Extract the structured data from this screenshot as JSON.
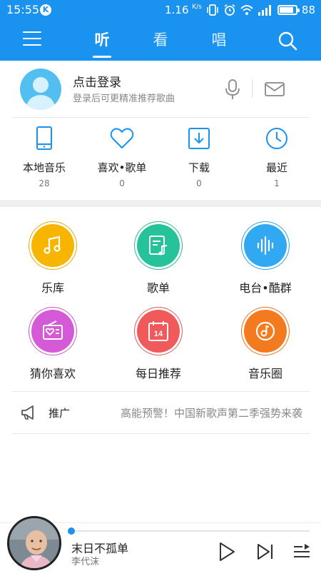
{
  "status_bar": {
    "time": "15:55",
    "k_badge": "K",
    "speed": "1.16",
    "speed_unit": "K/s",
    "battery": "88",
    "battery_level": 0.88
  },
  "nav": {
    "tabs": [
      {
        "label": "听",
        "active": true
      },
      {
        "label": "看",
        "active": false
      },
      {
        "label": "唱",
        "active": false
      }
    ],
    "icons": [
      "menu-icon",
      "search-icon"
    ]
  },
  "login": {
    "title": "点击登录",
    "subtitle": "登录后可更精准推荐歌曲",
    "icons": [
      "avatar-icon",
      "microphone-icon",
      "mail-icon"
    ]
  },
  "stats": [
    {
      "label": "本地音乐",
      "count": "28",
      "icon": "phone-icon"
    },
    {
      "label": "喜欢•歌单",
      "count": "0",
      "icon": "heart-icon"
    },
    {
      "label": "下载",
      "count": "0",
      "icon": "download-icon"
    },
    {
      "label": "最近",
      "count": "1",
      "icon": "clock-icon"
    }
  ],
  "grid": [
    {
      "label": "乐库",
      "icon": "music-note-icon",
      "color": "#f7b500"
    },
    {
      "label": "歌单",
      "icon": "playlist-icon",
      "color": "#26c39a"
    },
    {
      "label": "电台•酷群",
      "icon": "soundwave-icon",
      "color": "#31a8f2"
    },
    {
      "label": "猜你喜欢",
      "icon": "radio-heart-icon",
      "color": "#d55ad8"
    },
    {
      "label": "每日推荐",
      "icon": "calendar-icon",
      "color": "#f15a5a"
    },
    {
      "label": "音乐圈",
      "icon": "music-circle-icon",
      "color": "#f47a1f"
    }
  ],
  "calendar_day": "14",
  "promo": {
    "label": "推广",
    "text": "高能预警！中国新歌声第二季强势来袭",
    "icon": "megaphone-icon"
  },
  "player": {
    "title": "末日不孤单",
    "artist": "李代沫",
    "progress": 0.0,
    "icons": [
      "play-icon",
      "next-icon",
      "playlist-queue-icon"
    ],
    "accent": "#1a92f0"
  },
  "colors": {
    "brand": "#1a92f0",
    "icon_blue": "#1a92f0"
  }
}
